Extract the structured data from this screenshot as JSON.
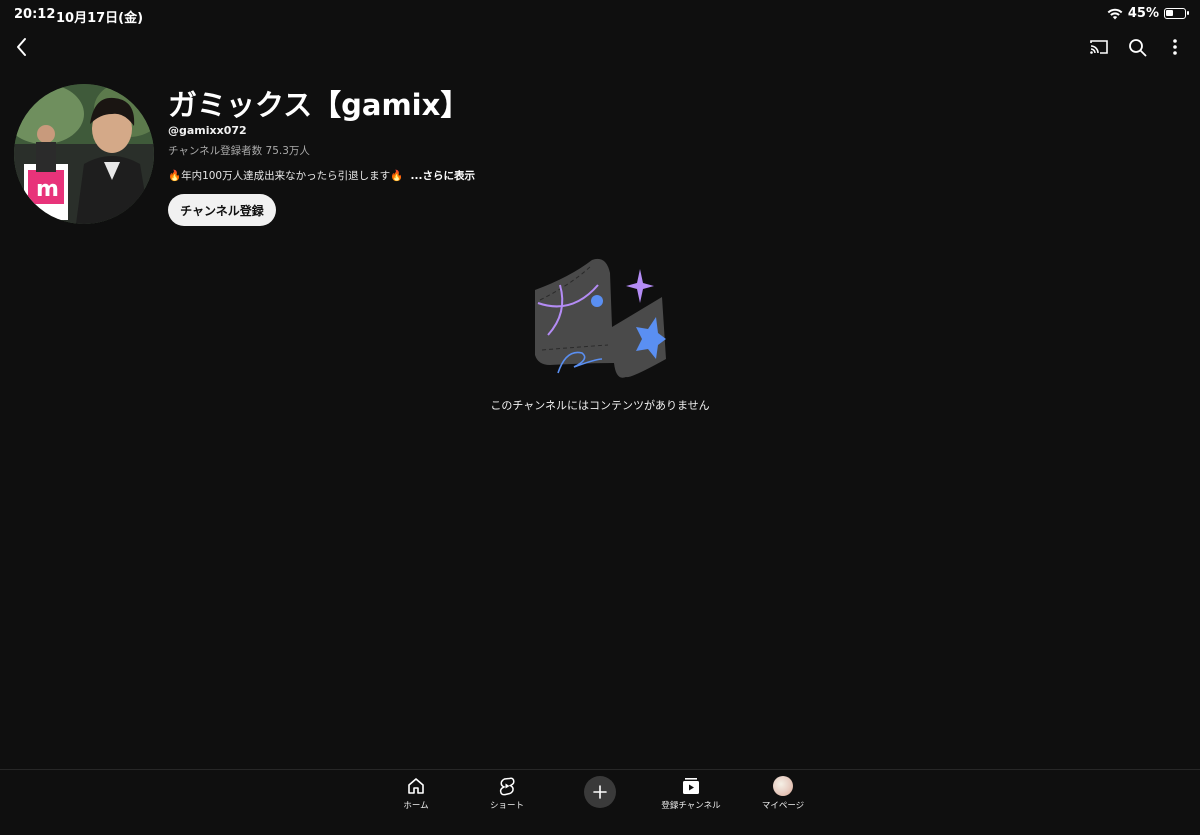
{
  "status_bar": {
    "time": "20:12",
    "date": "10月17日(金)",
    "battery_text": "45%",
    "battery_level": 0.45
  },
  "top_nav": {
    "back_icon": "chevron-left-icon",
    "cast_icon": "cast-icon",
    "search_icon": "search-icon",
    "more_icon": "more-vertical-icon"
  },
  "channel": {
    "title": "ガミックス【gamix】",
    "handle": "@gamixx072",
    "subscribers": "チャンネル登録者数 75.3万人",
    "description": "🔥年内100万人達成出来なかったら引退します🔥",
    "more_label": "...さらに表示",
    "subscribe_label": "チャンネル登録"
  },
  "empty_state": {
    "message": "このチャンネルにはコンテンツがありません"
  },
  "bottom_nav": {
    "items": [
      {
        "label": "ホーム",
        "icon": "home-icon"
      },
      {
        "label": "ショート",
        "icon": "shorts-icon"
      },
      {
        "label": "",
        "icon": "plus-icon"
      },
      {
        "label": "登録チャンネル",
        "icon": "subscriptions-icon"
      },
      {
        "label": "マイページ",
        "icon": "avatar"
      }
    ]
  },
  "colors": {
    "background": "#0f0f0f",
    "text": "#f1f1f1",
    "secondary_text": "#aaaaaa",
    "accent_purple": "#b48cf5",
    "accent_blue": "#5a8ff2"
  }
}
